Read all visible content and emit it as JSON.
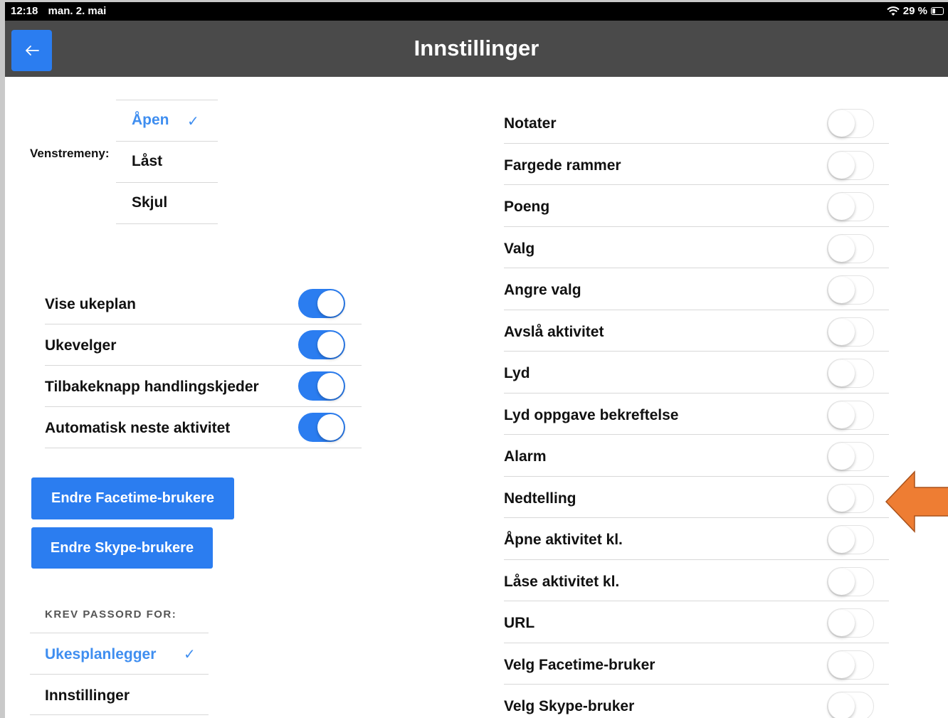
{
  "status_bar": {
    "time": "12:18",
    "date": "man. 2. mai",
    "battery": "29 %"
  },
  "header": {
    "title": "Innstillinger",
    "back_icon": "arrow-left-icon",
    "accent": "#2b7df0"
  },
  "venstremeny": {
    "label": "Venstremeny:",
    "options": [
      {
        "label": "Åpen",
        "selected": true
      },
      {
        "label": "Låst",
        "selected": false
      },
      {
        "label": "Skjul",
        "selected": false
      }
    ]
  },
  "left_toggles": [
    {
      "label": "Vise ukeplan",
      "on": true
    },
    {
      "label": "Ukevelger",
      "on": true
    },
    {
      "label": "Tilbakeknapp handlingskjeder",
      "on": true
    },
    {
      "label": "Automatisk neste aktivitet",
      "on": true
    }
  ],
  "buttons": {
    "facetime": "Endre Facetime-brukere",
    "skype": "Endre Skype-brukere"
  },
  "password": {
    "heading": "KREV PASSORD FOR:",
    "options": [
      {
        "label": "Ukesplanlegger",
        "selected": true
      },
      {
        "label": "Innstillinger",
        "selected": false
      }
    ]
  },
  "right_toggles": [
    {
      "label": "Notater",
      "on": false
    },
    {
      "label": "Fargede rammer",
      "on": false
    },
    {
      "label": "Poeng",
      "on": false
    },
    {
      "label": "Valg",
      "on": false
    },
    {
      "label": "Angre valg",
      "on": false
    },
    {
      "label": "Avslå aktivitet",
      "on": false
    },
    {
      "label": "Lyd",
      "on": false
    },
    {
      "label": "Lyd oppgave bekreftelse",
      "on": false
    },
    {
      "label": "Alarm",
      "on": false
    },
    {
      "label": "Nedtelling",
      "on": false
    },
    {
      "label": "Åpne aktivitet kl.",
      "on": false
    },
    {
      "label": "Låse aktivitet kl.",
      "on": false
    },
    {
      "label": "URL",
      "on": false
    },
    {
      "label": "Velg Facetime-bruker",
      "on": false
    },
    {
      "label": "Velg Skype-bruker",
      "on": false
    }
  ],
  "annotation": {
    "icon": "orange-arrow-icon",
    "color": "#ee7d33",
    "points_to": "Nedtelling"
  }
}
